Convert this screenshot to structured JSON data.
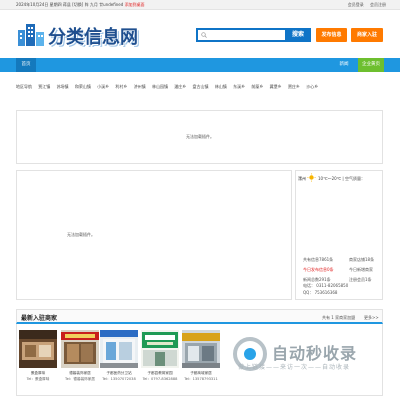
{
  "topbar": {
    "date": "2024年10月24日 星期四",
    "city_label": "蒋县",
    "switch": "[切换]",
    "weather": "阵 九月 廿undefined",
    "weather_link": "添加到桌面",
    "login": "会员登录",
    "register": "会员注册"
  },
  "logo": {
    "text": "分类信息网"
  },
  "search": {
    "placeholder": "",
    "button": "搜索"
  },
  "header_buttons": {
    "post": "发布信息",
    "join": "商家入驻"
  },
  "nav": {
    "home": "首页",
    "news": "新闻",
    "biz": "企业黄页"
  },
  "areas": [
    "地区导航",
    "贾江镇",
    "苏场镇",
    "和荣山镇",
    "小溪乡",
    "利村乡",
    "济州镇",
    "林山园镇",
    "潘庄乡",
    "盘古山镇",
    "林山镇",
    "东溪乡",
    "前厦乡",
    "冀堡乡",
    "贾庄乡",
    "沙心乡"
  ],
  "messages": {
    "main": "无法加载插件。",
    "left": "无法加载插件。"
  },
  "weather": {
    "city": "漯州",
    "temp": "10℃～20℃ | 空气质量："
  },
  "right_links": [
    {
      "a": "共有信息7861条",
      "b": "商家店铺18条"
    },
    {
      "a": "今日发布信息0条",
      "b": "今日新增商家"
    },
    {
      "a": "新闻总数291条",
      "b": "注册会员1条"
    }
  ],
  "contact": {
    "phone": "电话： 0311-82065850",
    "qq": "QQ：     753616368"
  },
  "merchants": {
    "title": "最新入驻商家",
    "count": "共有 1 家商家加盟",
    "more": "更多>>",
    "cards": [
      {
        "name": "蛋盒厚味",
        "tel": "Tel：蛋盒厚味"
      },
      {
        "name": "德馨装饰家居",
        "tel": "Tel：德馨装饰家居"
      },
      {
        "name": "子都医药分卫站",
        "tel": "Tel：13507072038"
      },
      {
        "name": "子都县教育家园",
        "tel": "Tel：0797-8362888"
      },
      {
        "name": "子都商城家居",
        "tel": "Tel：13578793311"
      }
    ]
  },
  "watermark": {
    "title": "自动秒收录",
    "sub": "做上链接——来访一次——自动收录"
  },
  "colors": {
    "primary": "#1f97e0",
    "accent": "#ff7a00",
    "green": "#6dbf2f"
  }
}
